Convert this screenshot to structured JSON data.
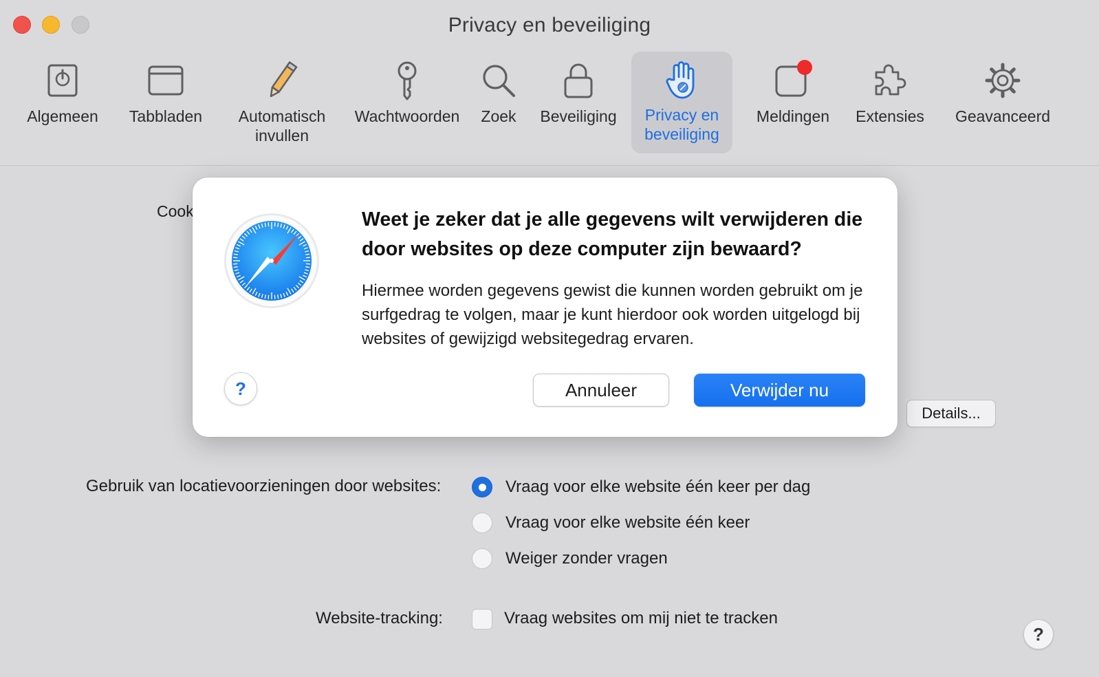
{
  "window": {
    "title": "Privacy en beveiliging"
  },
  "toolbar": {
    "items": [
      {
        "label": "Algemeen",
        "icon": "switch-icon"
      },
      {
        "label": "Tabbladen",
        "icon": "tabs-icon"
      },
      {
        "label": "Automatisch\ninvullen",
        "icon": "pencil-icon"
      },
      {
        "label": "Wachtwoorden",
        "icon": "key-icon"
      },
      {
        "label": "Zoek",
        "icon": "search-icon"
      },
      {
        "label": "Beveiliging",
        "icon": "lock-icon"
      },
      {
        "label": "Privacy en\nbeveiliging",
        "icon": "hand-icon",
        "selected": true
      },
      {
        "label": "Meldingen",
        "icon": "notification-icon"
      },
      {
        "label": "Extensies",
        "icon": "puzzle-icon"
      },
      {
        "label": "Geavanceerd",
        "icon": "gear-icon"
      }
    ],
    "accent_color": "#1f6fe0",
    "badge_color": "#ee2a2a"
  },
  "settings": {
    "cookies_label_partial": "Cook",
    "details_button": "Details...",
    "location_label": "Gebruik van locatievoorzieningen door websites:",
    "location_options": [
      {
        "label": "Vraag voor elke website één keer per dag",
        "selected": true
      },
      {
        "label": "Vraag voor elke website één keer",
        "selected": false
      },
      {
        "label": "Weiger zonder vragen",
        "selected": false
      }
    ],
    "tracking_label": "Website-tracking:",
    "tracking_option": "Vraag websites om mij niet te tracken",
    "tracking_checked": false,
    "help_button": "?"
  },
  "dialog": {
    "app_icon": "safari-compass-icon",
    "title": "Weet je zeker dat je alle gegevens wilt verwijderen die door websites op deze computer zijn bewaard?",
    "body": "Hiermee worden gegevens gewist die kunnen worden gebruikt om je surfgedrag te volgen, maar je kunt hierdoor ook worden uitgelogd bij websites of gewijzigd websitegedrag ervaren.",
    "help_button": "?",
    "cancel_button": "Annuleer",
    "confirm_button": "Verwijder nu",
    "confirm_color": "#1f76f0"
  }
}
